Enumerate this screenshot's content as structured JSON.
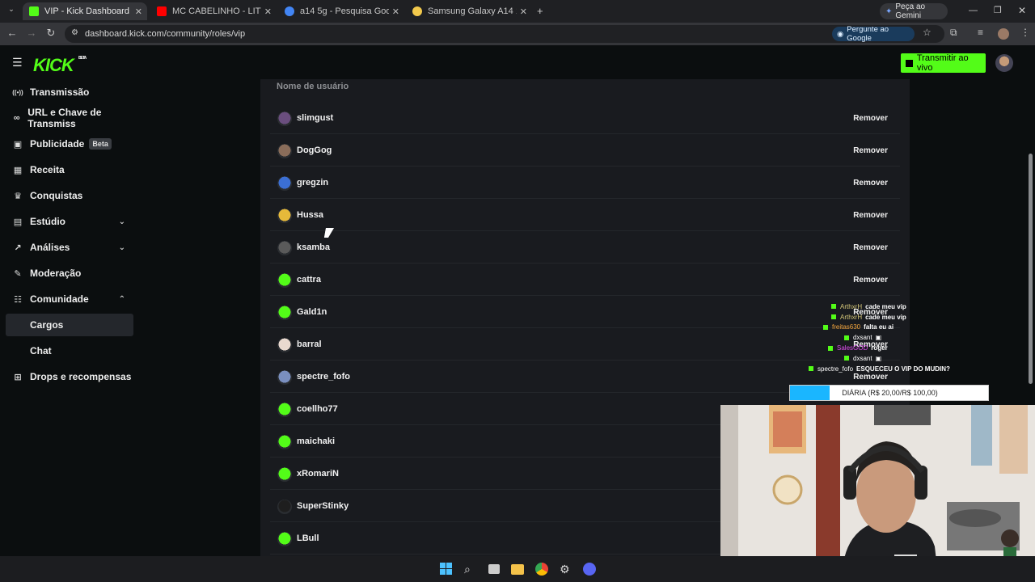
{
  "browser": {
    "tabs": [
      {
        "label": "VIP - Kick Dashboard",
        "favicon": "#53fc18",
        "active": true
      },
      {
        "label": "MC CABELINHO - LITTLE HAIR",
        "favicon": "#ff0000",
        "active": false
      },
      {
        "label": "a14 5g - Pesquisa Google",
        "favicon": "#4285f4",
        "active": false
      },
      {
        "label": "Samsung Galaxy A14 128 GB 4",
        "favicon": "#f2c94c",
        "active": false
      }
    ],
    "gemini_label": "Peça ao Gemini",
    "url": "dashboard.kick.com/community/roles/vip",
    "ask_google": "Pergunte ao Google"
  },
  "header": {
    "logo": "KICK",
    "logo_sup": "BETA",
    "go_live": "Transmitir ao vivo"
  },
  "sidebar": {
    "items": [
      {
        "label": "Transmissão",
        "icon": "broadcast-icon",
        "glyph": "((•))"
      },
      {
        "label": "URL e Chave de Transmiss",
        "icon": "link-icon",
        "glyph": "🔗"
      },
      {
        "label": "Publicidade",
        "icon": "megaphone-icon",
        "glyph": "▣",
        "badge": "Beta"
      },
      {
        "label": "Receita",
        "icon": "bank-icon",
        "glyph": "▦"
      },
      {
        "label": "Conquistas",
        "icon": "trophy-icon",
        "glyph": "🏆"
      },
      {
        "label": "Estúdio",
        "icon": "grid-icon",
        "glyph": "▤"
      },
      {
        "label": "Análises",
        "icon": "chart-icon",
        "glyph": "↗"
      },
      {
        "label": "Moderação",
        "icon": "wrench-icon",
        "glyph": "✎"
      },
      {
        "label": "Comunidade",
        "icon": "community-icon",
        "glyph": "☷"
      },
      {
        "label": "Cargos",
        "icon": "",
        "glyph": ""
      },
      {
        "label": "Chat",
        "icon": "",
        "glyph": ""
      },
      {
        "label": "Drops e recompensas",
        "icon": "gift-icon",
        "glyph": "⊞"
      }
    ]
  },
  "main": {
    "column_header": "Nome de usuário",
    "remove_label": "Remover",
    "users": [
      {
        "name": "slimgust",
        "avatar": "#6a4e7e"
      },
      {
        "name": "DogGog",
        "avatar": "#8a6d5a"
      },
      {
        "name": "gregzin",
        "avatar": "#3b6fd4"
      },
      {
        "name": "Hussa",
        "avatar": "#e6b93a"
      },
      {
        "name": "ksamba",
        "avatar": "#5a5a5a"
      },
      {
        "name": "cattra",
        "avatar": "#53fc18"
      },
      {
        "name": "Gald1n",
        "avatar": "#53fc18"
      },
      {
        "name": "barral",
        "avatar": "#e9d9cf"
      },
      {
        "name": "spectre_fofo",
        "avatar": "#7a8fbf"
      },
      {
        "name": "coellho77",
        "avatar": "#53fc18"
      },
      {
        "name": "maichaki",
        "avatar": "#53fc18"
      },
      {
        "name": "xRomariN",
        "avatar": "#53fc18"
      },
      {
        "name": "SuperStinky",
        "avatar": "#1e1e1e"
      },
      {
        "name": "LBull",
        "avatar": "#53fc18"
      }
    ]
  },
  "overlay": {
    "chat": [
      {
        "user": "ArthxrH",
        "color": "#d7c97a",
        "msg": "cade meu vip"
      },
      {
        "user": "ArthxrH",
        "color": "#d7c97a",
        "msg": "cade meu vip"
      },
      {
        "user": "freitas630",
        "color": "#f0a33c",
        "msg": "falta eu ai"
      },
      {
        "user": "dxsant",
        "color": "#ffffff",
        "msg": "▣"
      },
      {
        "user": "SalesGOD",
        "color": "#e04ef0",
        "msg": "roger"
      },
      {
        "user": "dxsant",
        "color": "#ffffff",
        "msg": "▣"
      },
      {
        "user": "spectre_fofo",
        "color": "#ffffff",
        "msg": "ESQUECEU O VIP DO MUDIN?"
      }
    ],
    "goal_label": "DIÁRIA (R$ 20,00/R$ 100,00)",
    "goal_fraction": 0.2
  },
  "colors": {
    "accent": "#53fc18",
    "panel": "#191b1f",
    "background": "#0b0e0f"
  }
}
